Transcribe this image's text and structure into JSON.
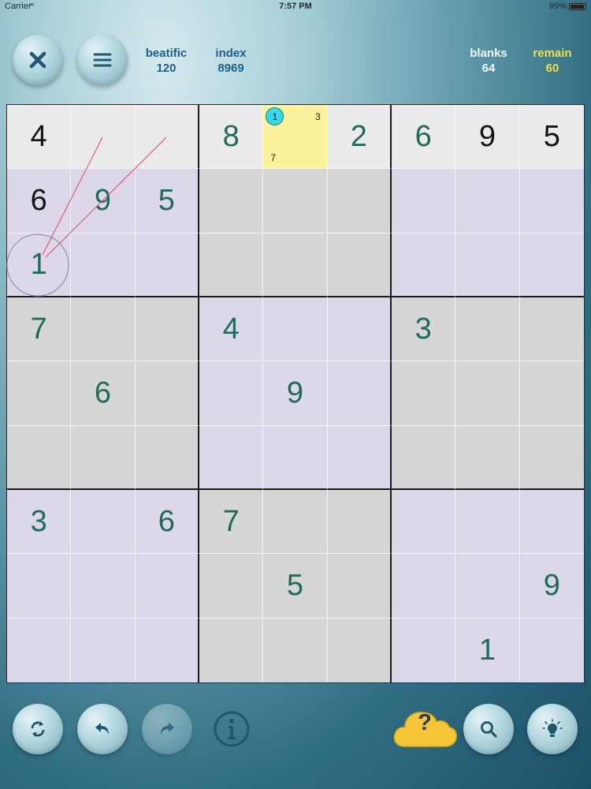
{
  "status_bar": {
    "carrier": "Carrier",
    "wifi_icon": "wifi-icon",
    "time": "7:57 PM",
    "battery": "99%"
  },
  "header": {
    "close_button": "close-icon",
    "menu_button": "menu-icon",
    "stats": [
      {
        "label": "beatific",
        "value": "120",
        "color": "blue"
      },
      {
        "label": "index",
        "value": "8969",
        "color": "blue"
      },
      {
        "label": "blanks",
        "value": "64",
        "color": "white"
      },
      {
        "label": "remain",
        "value": "60",
        "color": "yellow"
      }
    ]
  },
  "board": {
    "digits": [
      [
        "4",
        "",
        "",
        "8",
        "",
        "2",
        "6",
        "9",
        "5"
      ],
      [
        "6",
        "9",
        "5",
        "",
        "",
        "",
        "",
        "",
        ""
      ],
      [
        "1",
        "",
        "",
        "",
        "",
        "",
        "",
        "",
        ""
      ],
      [
        "7",
        "",
        "",
        "4",
        "",
        "",
        "3",
        "",
        ""
      ],
      [
        "",
        "6",
        "",
        "",
        "9",
        "",
        "",
        "",
        ""
      ],
      [
        "",
        "",
        "",
        "",
        "",
        "",
        "",
        "",
        ""
      ],
      [
        "3",
        "",
        "6",
        "7",
        "",
        "",
        "",
        "",
        ""
      ],
      [
        "",
        "",
        "",
        "",
        "5",
        "",
        "",
        "",
        "9"
      ],
      [
        "",
        "",
        "",
        "",
        "",
        "",
        "",
        "1",
        ""
      ]
    ],
    "given": [
      [
        0,
        0
      ],
      [
        0,
        7
      ],
      [
        0,
        8
      ],
      [
        1,
        0
      ]
    ],
    "selected_cell": {
      "row": 0,
      "col": 4,
      "notes": {
        "circled": "1",
        "top_right": "3",
        "bottom_left": "7"
      }
    },
    "hint": {
      "circled_cell": {
        "row": 2,
        "col": 0
      },
      "line_color": "#e0485a"
    },
    "colors": {
      "lavender": "#dcd8ea",
      "gray": "#d6d6d6",
      "top_row": "#ebebeb",
      "selected": "#fbf29b",
      "digit_green": "#1e6b5a",
      "digit_black": "#141414"
    }
  },
  "toolbar": {
    "left": [
      "refresh-icon",
      "undo-icon",
      "redo-icon",
      "info-icon"
    ],
    "right": [
      "help-cloud-icon",
      "search-icon",
      "lightbulb-icon"
    ],
    "help_label": "?",
    "redo_disabled": true
  }
}
